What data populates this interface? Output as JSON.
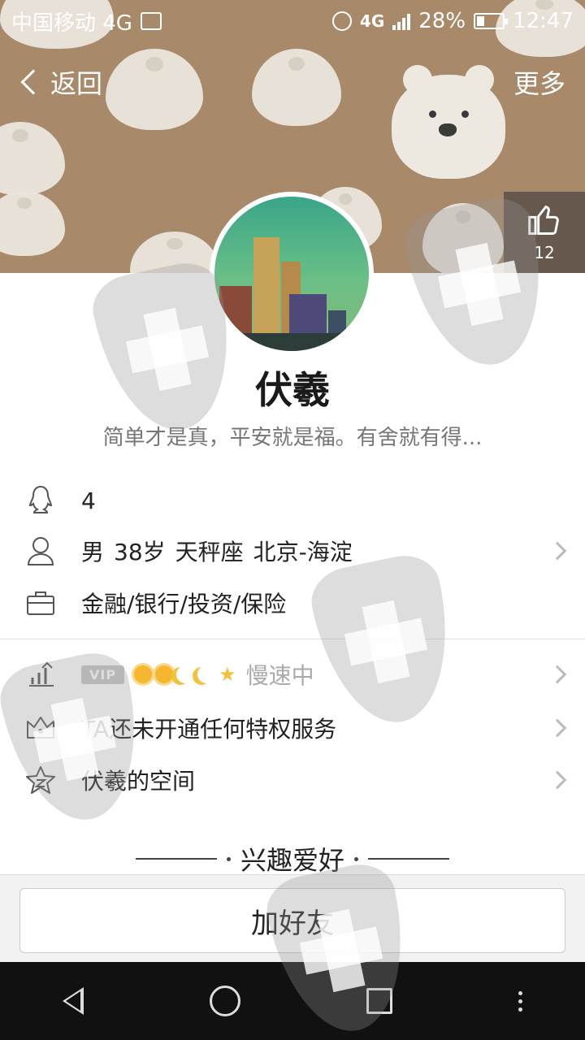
{
  "status_bar": {
    "carrier": "中国移动 4G",
    "network": "4G",
    "battery": "28%",
    "time": "12:47"
  },
  "nav": {
    "back_label": "返回",
    "more_label": "更多"
  },
  "like": {
    "count": "12"
  },
  "profile": {
    "name": "伏羲",
    "signature": "简单才是真，平安就是福。有舍就有得..."
  },
  "info": {
    "qq_number": "4",
    "gender": "男",
    "age": "38岁",
    "zodiac": "天秤座",
    "location": "北京-海淀",
    "industry": "金融/银行/投资/保险"
  },
  "vip": {
    "badge": "VIP",
    "speed_status": "慢速中"
  },
  "privilege": {
    "text": "TA还未开通任何特权服务"
  },
  "space": {
    "label": "伏羲的空间"
  },
  "hobby": {
    "title": "兴趣爱好"
  },
  "actions": {
    "add_friend": "加好友"
  }
}
